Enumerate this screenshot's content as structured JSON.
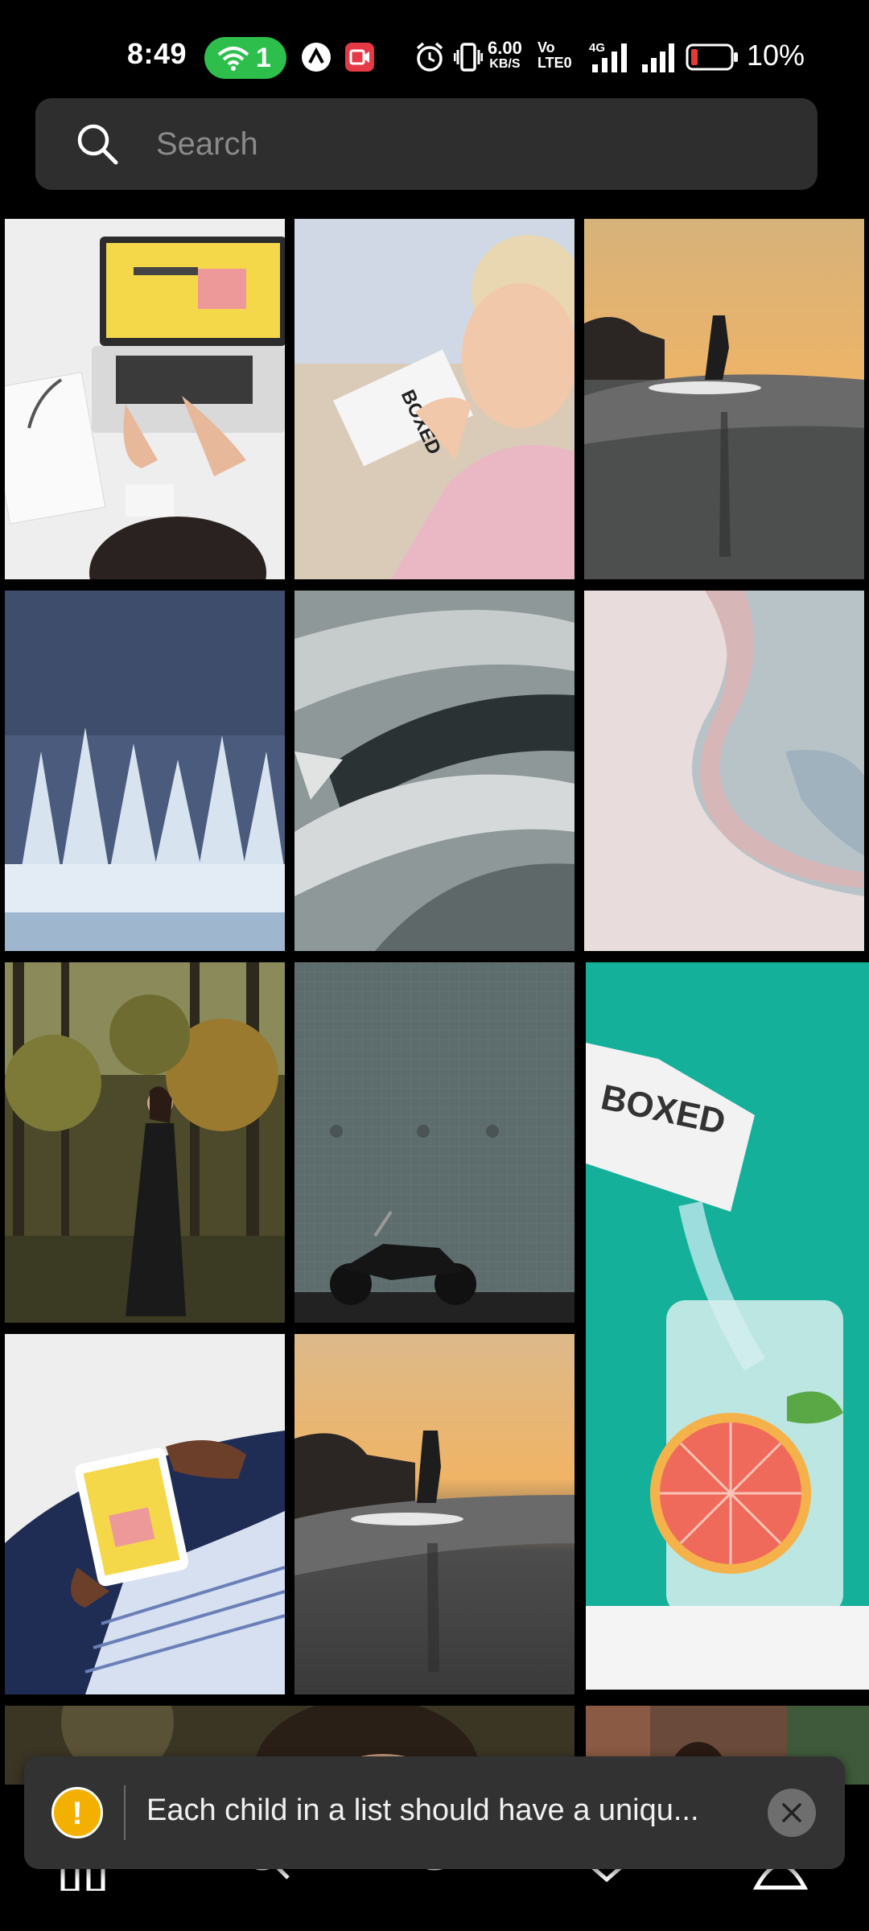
{
  "status_bar": {
    "time": "8:49",
    "hotspot_count": "1",
    "net_speed": "6.00",
    "net_speed_unit": "KB/S",
    "volte_line1": "Vo",
    "volte_line2": "LTE0",
    "network": "4G",
    "battery_percent": "10%",
    "colors": {
      "hotspot": "#2dbe4c",
      "battery_low": "#e53935"
    }
  },
  "search": {
    "placeholder": "Search"
  },
  "grid": {
    "items": [
      {
        "description": "woman-laptop"
      },
      {
        "description": "girl-drinking-boxed-water"
      },
      {
        "description": "surfer-sunset"
      },
      {
        "description": "snowy-forest"
      },
      {
        "description": "abstract-grey-shapes"
      },
      {
        "description": "abstract-pink-wave"
      },
      {
        "description": "woman-forest"
      },
      {
        "description": "motorcycle-wall"
      },
      {
        "description": "boxed-water-grapefruit"
      },
      {
        "description": "man-tablet"
      },
      {
        "description": "surfer-sunset-2"
      }
    ]
  },
  "toast": {
    "icon": "warning-icon",
    "message": "Each child in a list should have a uniqu...",
    "colors": {
      "warning": "#f4b000"
    }
  },
  "bottom_nav": {
    "icons": [
      "home-icon",
      "search-icon",
      "add-icon",
      "heart-icon",
      "profile-icon"
    ]
  }
}
